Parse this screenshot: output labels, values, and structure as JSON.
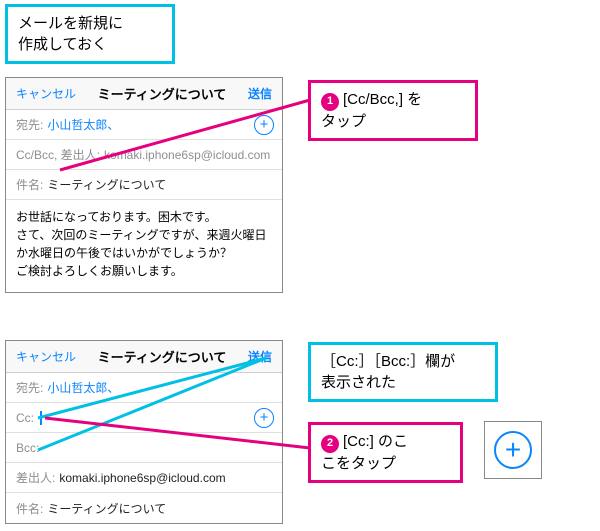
{
  "note_top": "メールを新規に\n作成しておく",
  "callout1": {
    "step": "1",
    "text": "[Cc/Bcc,] を\nタップ"
  },
  "note_mid": "［Cc:］［Bcc:］欄が\n表示された",
  "callout2": {
    "step": "2",
    "text": "[Cc:] のこ\nこをタップ"
  },
  "panel1": {
    "cancel": "キャンセル",
    "title": "ミーティングについて",
    "send": "送信",
    "to_label": "宛先:",
    "to_value": "小山哲太郎、",
    "ccbcc_label": "Cc/Bcc, 差出人:",
    "ccbcc_value": "komaki.iphone6sp@icloud.com",
    "subject_label": "件名:",
    "subject_value": "ミーティングについて",
    "body": "お世話になっております。困木です。\nさて、次回のミーティングですが、来週火曜日か水曜日の午後ではいかがでしょうか？\nご検討よろしくお願いします。"
  },
  "panel2": {
    "cancel": "キャンセル",
    "title": "ミーティングについて",
    "send": "送信",
    "to_label": "宛先:",
    "to_value": "小山哲太郎、",
    "cc_label": "Cc:",
    "bcc_label": "Bcc:",
    "from_label": "差出人:",
    "from_value": "komaki.iphone6sp@icloud.com",
    "subject_label": "件名:",
    "subject_value": "ミーティングについて"
  }
}
